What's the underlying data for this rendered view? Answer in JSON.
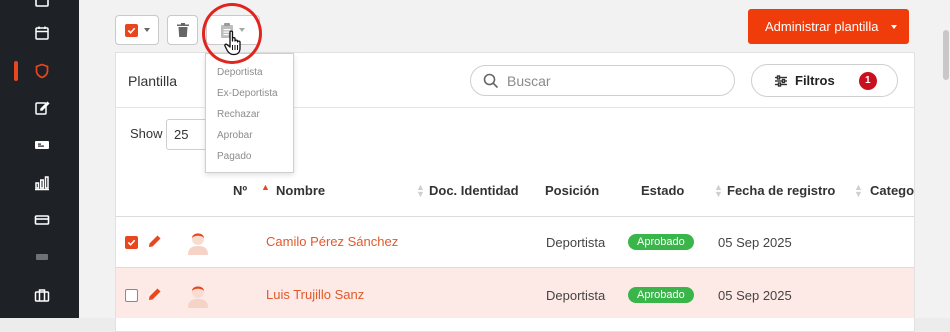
{
  "sidebar": {
    "icons": [
      "toggle-icon",
      "calendar-icon",
      "shield-icon",
      "edit-icon",
      "ticket-icon",
      "bar-chart-icon",
      "card-icon",
      "tag-icon",
      "briefcase-icon"
    ],
    "active": "shield-icon"
  },
  "toolbar": {
    "admin_label": "Administrar plantilla"
  },
  "card": {
    "title": "Plantilla",
    "search_placeholder": "Buscar",
    "filters_label": "Filtros",
    "filters_count": "1",
    "show_label": "Show",
    "show_value": "25"
  },
  "dropdown": {
    "items": [
      "Deportista",
      "Ex-Deportista",
      "Rechazar",
      "Aprobar",
      "Pagado"
    ]
  },
  "table": {
    "headers": [
      "Nº",
      "Nombre",
      "Doc. Identidad",
      "Posición",
      "Estado",
      "Fecha de registro",
      "Catego"
    ],
    "rows": [
      {
        "checked": true,
        "name": "Camilo Pérez Sánchez",
        "doc": "",
        "position": "Deportista",
        "status": "Aprobado",
        "date": "05 Sep 2025"
      },
      {
        "checked": false,
        "name": "Luis Trujillo Sanz",
        "doc": "",
        "position": "Deportista",
        "status": "Aprobado",
        "date": "05 Sep 2025"
      }
    ]
  },
  "colors": {
    "accent": "#f03c0a",
    "sidebar_bg": "#1e2126",
    "success": "#39b54a",
    "highlight_row": "#fde9e5"
  }
}
